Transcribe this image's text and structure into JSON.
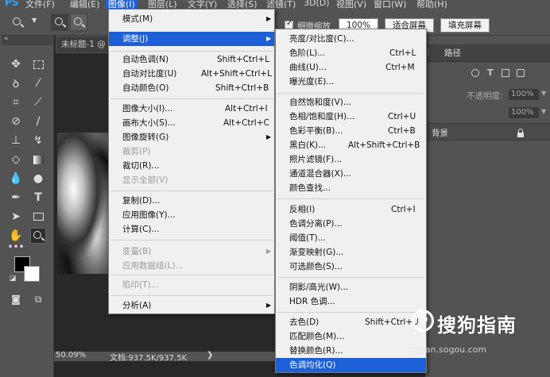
{
  "menubar": {
    "logo": "PS",
    "items": [
      "文件(F)",
      "编辑(E)",
      "图像(I)",
      "图层(L)",
      "文字(Y)",
      "选择(S)",
      "滤镜(T)",
      "3D(D)",
      "视图(V)",
      "窗口(W)",
      "帮助(H)"
    ]
  },
  "options": {
    "resize_label": "细微缩放",
    "zoom_value": "100%",
    "fit_screen": "适合屏幕",
    "fill_screen": "填充屏幕"
  },
  "document": {
    "tab_title": "未标题-1 @",
    "zoom_level": "50.09%",
    "doc_size": "文档:937.5K/937.5K"
  },
  "right_panel": {
    "tab_paths": "路径",
    "opacity_label": "不透明度:",
    "opacity_value": "100%",
    "fill_value": "100%",
    "layer_name": "背景"
  },
  "image_menu": {
    "items": [
      {
        "label": "模式(M)",
        "shortcut": "",
        "arrow": true,
        "disabled": false
      },
      {
        "label": "调整(J)",
        "shortcut": "",
        "arrow": true,
        "disabled": false,
        "highlight": true
      },
      {
        "label": "自动色调(N)",
        "shortcut": "Shift+Ctrl+L",
        "disabled": false
      },
      {
        "label": "自动对比度(U)",
        "shortcut": "Alt+Shift+Ctrl+L",
        "disabled": false
      },
      {
        "label": "自动颜色(O)",
        "shortcut": "Shift+Ctrl+B",
        "disabled": false
      },
      {
        "label": "图像大小(I)...",
        "shortcut": "Alt+Ctrl+I",
        "disabled": false
      },
      {
        "label": "画布大小(S)...",
        "shortcut": "Alt+Ctrl+C",
        "disabled": false
      },
      {
        "label": "图像旋转(G)",
        "shortcut": "",
        "arrow": true,
        "disabled": false
      },
      {
        "label": "裁剪(P)",
        "shortcut": "",
        "disabled": true
      },
      {
        "label": "裁切(R)...",
        "shortcut": "",
        "disabled": false
      },
      {
        "label": "显示全部(V)",
        "shortcut": "",
        "disabled": true
      },
      {
        "label": "复制(D)...",
        "shortcut": "",
        "disabled": false
      },
      {
        "label": "应用图像(Y)...",
        "shortcut": "",
        "disabled": false
      },
      {
        "label": "计算(C)...",
        "shortcut": "",
        "disabled": false
      },
      {
        "label": "变量(B)",
        "shortcut": "",
        "arrow": true,
        "disabled": true
      },
      {
        "label": "应用数据组(L)...",
        "shortcut": "",
        "disabled": true
      },
      {
        "label": "陷印(T)...",
        "shortcut": "",
        "disabled": true
      },
      {
        "label": "分析(A)",
        "shortcut": "",
        "arrow": true,
        "disabled": false
      }
    ]
  },
  "adjust_menu": {
    "items": [
      {
        "label": "亮度/对比度(C)...",
        "shortcut": ""
      },
      {
        "label": "色阶(L)...",
        "shortcut": "Ctrl+L"
      },
      {
        "label": "曲线(U)...",
        "shortcut": "Ctrl+M"
      },
      {
        "label": "曝光度(E)...",
        "shortcut": ""
      },
      {
        "label": "自然饱和度(V)...",
        "shortcut": ""
      },
      {
        "label": "色相/饱和度(H)...",
        "shortcut": "Ctrl+U"
      },
      {
        "label": "色彩平衡(B)...",
        "shortcut": "Ctrl+B"
      },
      {
        "label": "黑白(K)...",
        "shortcut": "Alt+Shift+Ctrl+B"
      },
      {
        "label": "照片滤镜(F)...",
        "shortcut": ""
      },
      {
        "label": "通道混合器(X)...",
        "shortcut": ""
      },
      {
        "label": "颜色查找...",
        "shortcut": ""
      },
      {
        "label": "反相(I)",
        "shortcut": "Ctrl+I"
      },
      {
        "label": "色调分离(P)...",
        "shortcut": ""
      },
      {
        "label": "阈值(T)...",
        "shortcut": ""
      },
      {
        "label": "渐变映射(G)...",
        "shortcut": ""
      },
      {
        "label": "可选颜色(S)...",
        "shortcut": ""
      },
      {
        "label": "阴影/高光(W)...",
        "shortcut": ""
      },
      {
        "label": "HDR 色调...",
        "shortcut": ""
      },
      {
        "label": "去色(D)",
        "shortcut": "Shift+Ctrl+U"
      },
      {
        "label": "匹配颜色(M)...",
        "shortcut": ""
      },
      {
        "label": "替换颜色(R)...",
        "shortcut": ""
      },
      {
        "label": "色调均化(Q)",
        "shortcut": "",
        "highlight": true
      }
    ]
  },
  "watermark": {
    "brand": "搜狗指南",
    "url": "zhinan.sogou.com"
  },
  "colors": {
    "highlight": "#1d5fd6",
    "menu_bg": "#f0f0f0",
    "app_bg": "#535353"
  }
}
